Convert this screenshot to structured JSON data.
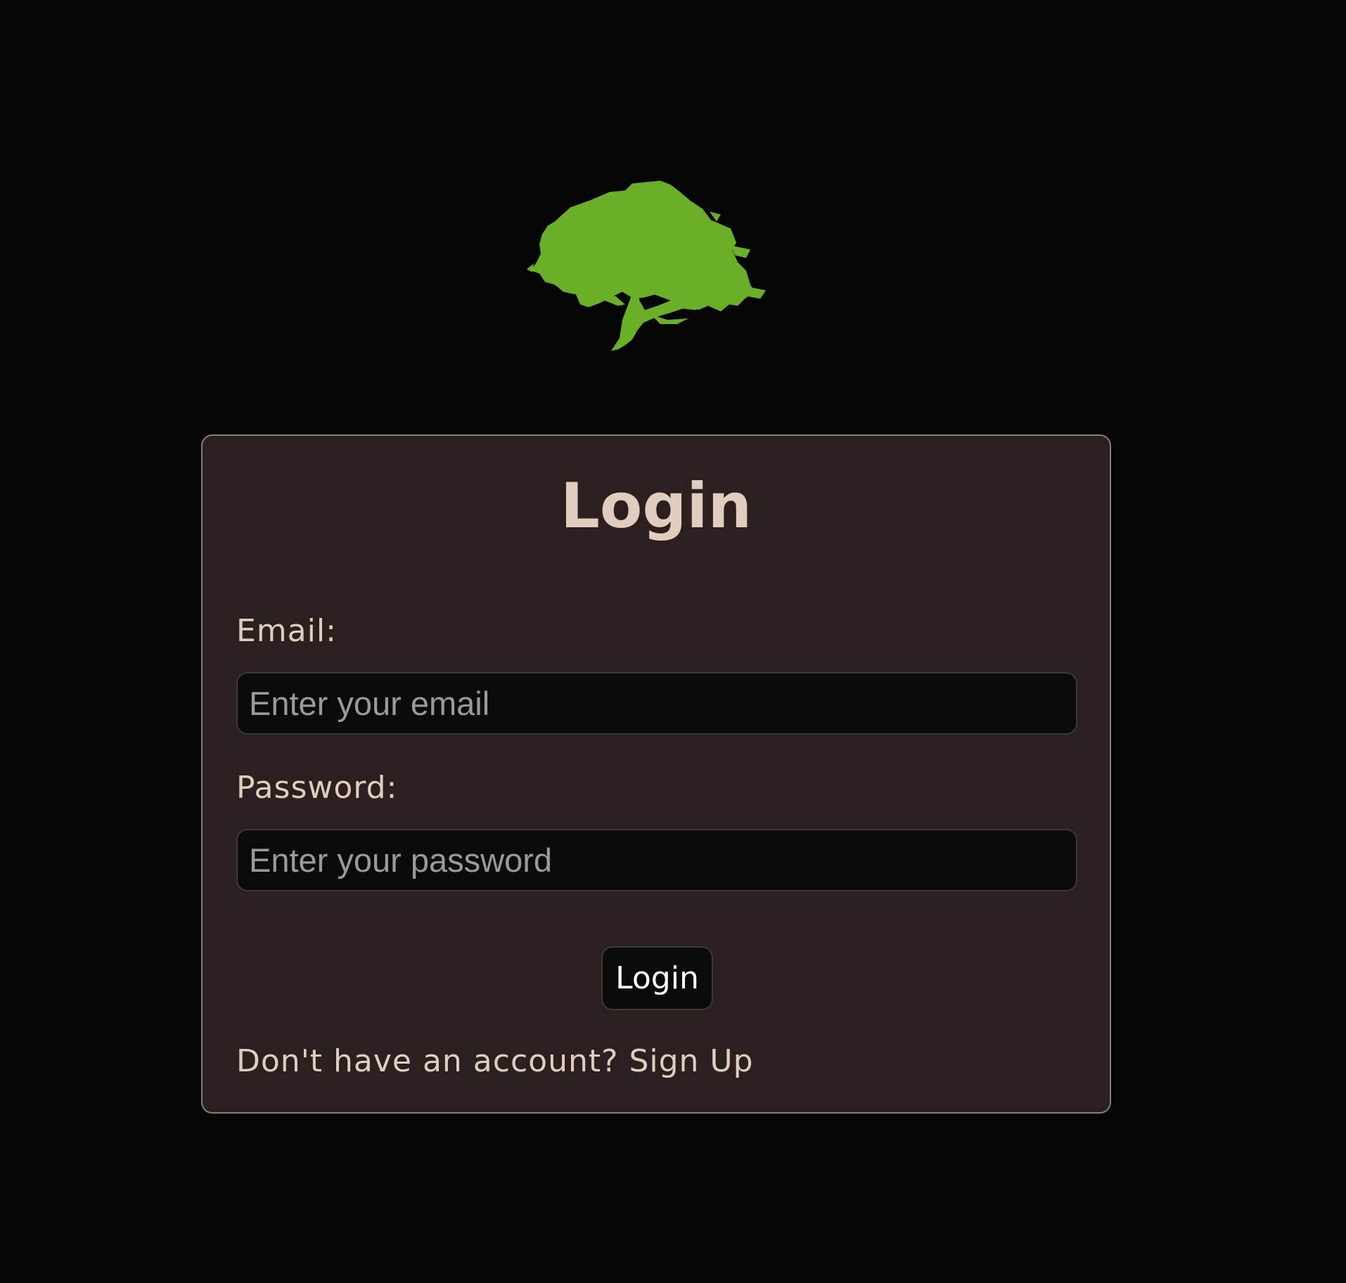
{
  "colors": {
    "background": "#050505",
    "card": "#2c1f1f",
    "card_border": "#8a7c77",
    "text": "#e0cdbf",
    "input_bg": "#0b0b0b",
    "logo_green": "#6aaf28"
  },
  "logo": {
    "icon": "tree-icon"
  },
  "login_form": {
    "title": "Login",
    "email": {
      "label": "Email:",
      "placeholder": "Enter your email",
      "value": ""
    },
    "password": {
      "label": "Password:",
      "placeholder": "Enter your password",
      "value": ""
    },
    "submit_label": "Login",
    "signup_prompt": "Don't have an account?",
    "signup_link": "Sign Up"
  }
}
